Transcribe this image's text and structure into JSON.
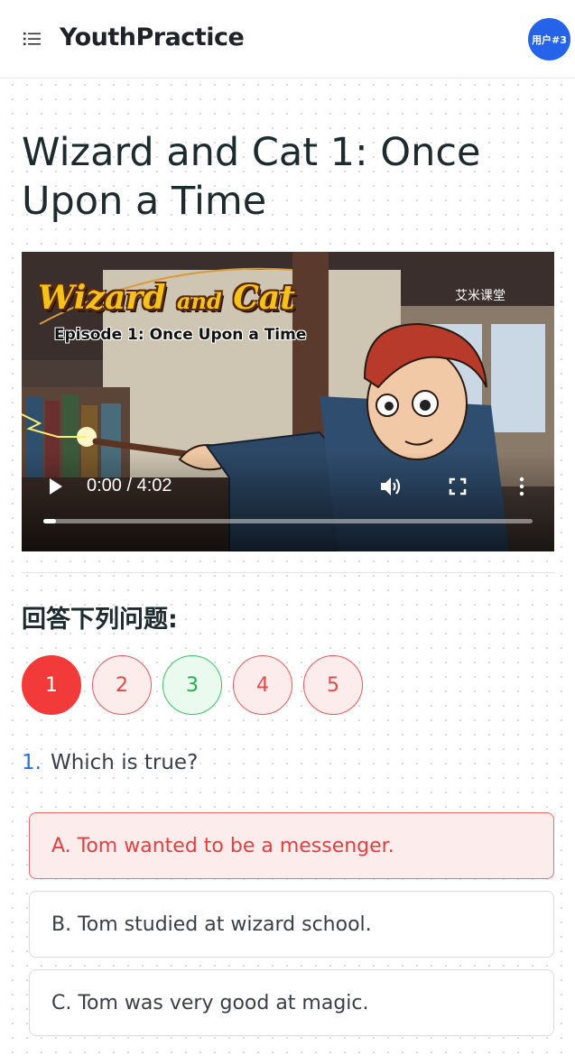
{
  "header": {
    "brand": "YouthPractice",
    "user_label": "用户#3"
  },
  "page": {
    "title": "Wizard and Cat 1: Once Upon a Time"
  },
  "video": {
    "logo_main": "Wizard",
    "logo_and": "and",
    "logo_cat": "Cat",
    "episode": "Episode 1: Once Upon a Time",
    "watermark": "艾米课堂",
    "time": "0:00 / 4:02",
    "progress": 0
  },
  "quiz": {
    "heading": "回答下列问题:",
    "nav": [
      {
        "label": "1",
        "state": "active"
      },
      {
        "label": "2",
        "state": "wrong"
      },
      {
        "label": "3",
        "state": "correct"
      },
      {
        "label": "4",
        "state": "wrong"
      },
      {
        "label": "5",
        "state": "wrong"
      }
    ],
    "question_number": "1.",
    "question_text": "Which is true?",
    "options": [
      {
        "label": "A. Tom wanted to be a messenger.",
        "state": "selected-wrong"
      },
      {
        "label": "B. Tom studied at wizard school.",
        "state": "default"
      },
      {
        "label": "C. Tom was very good at magic.",
        "state": "default"
      }
    ]
  },
  "colors": {
    "accent_blue": "#2563eb",
    "active_red": "#f23a3a",
    "wrong_red": "#e54848",
    "correct_green": "#22b04f"
  }
}
